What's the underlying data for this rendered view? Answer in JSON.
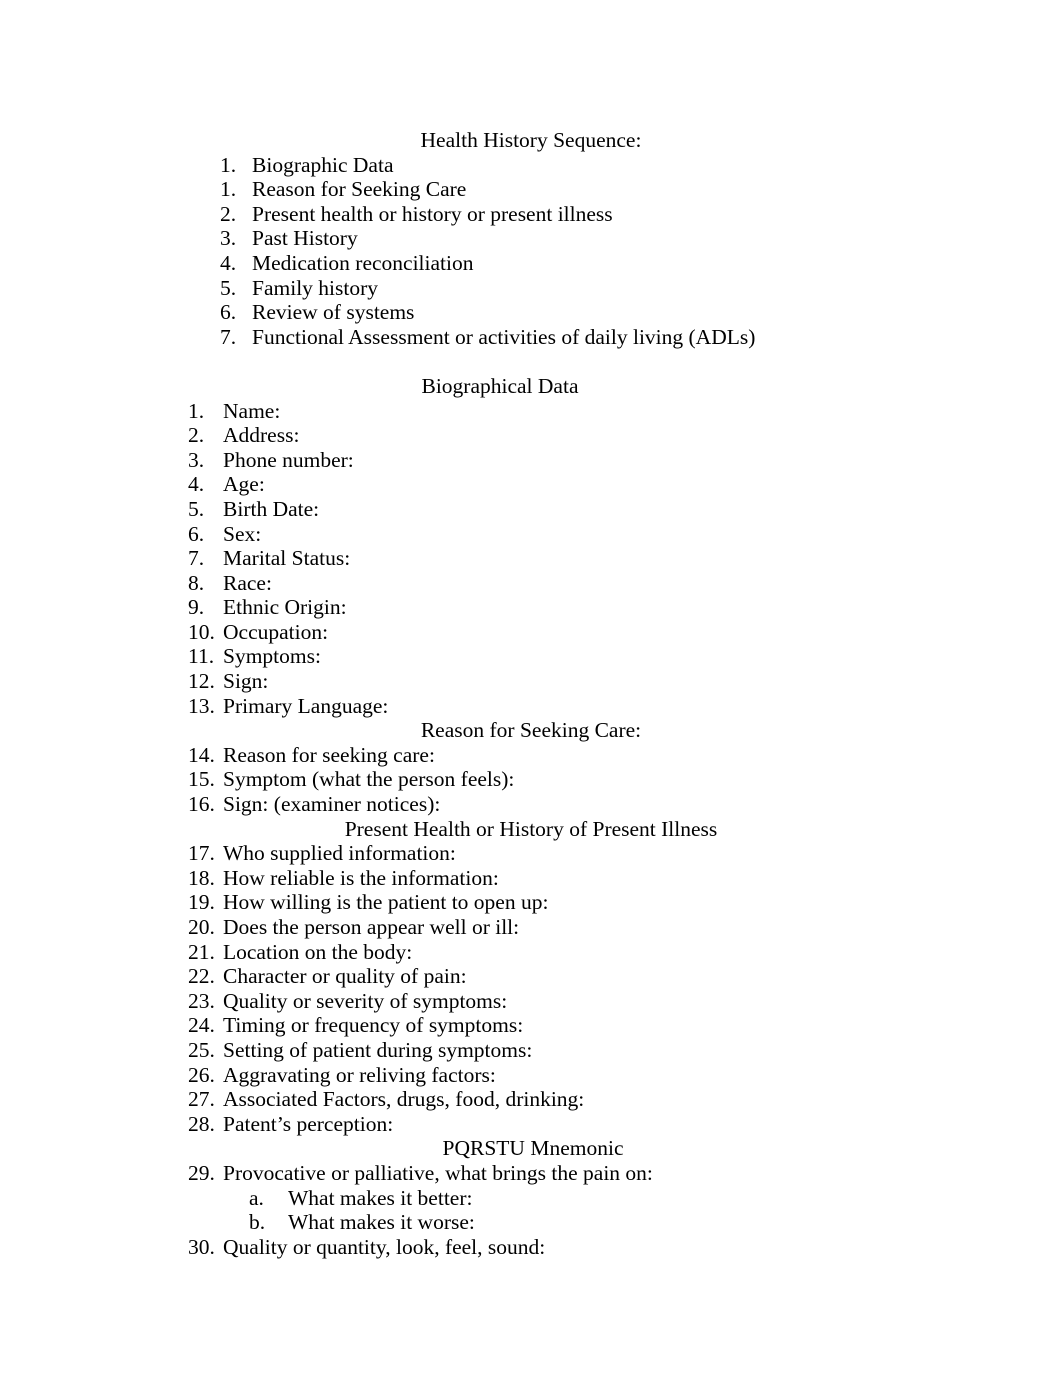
{
  "document": {
    "title": "Health History Sequence:",
    "sections": [
      {
        "id": "health-history-sequence",
        "heading": "Health History Sequence:",
        "heading_style": "h-main",
        "list_style": "list-a",
        "items": [
          {
            "num": "1.",
            "text": "Biographic Data"
          },
          {
            "num": "1.",
            "text": "Reason for Seeking Care"
          },
          {
            "num": "2.",
            "text": "Present health or history or present illness"
          },
          {
            "num": "3.",
            "text": "Past History"
          },
          {
            "num": "4.",
            "text": "Medication reconciliation"
          },
          {
            "num": "5.",
            "text": "Family history"
          },
          {
            "num": "6.",
            "text": "Review of systems"
          },
          {
            "num": "7.",
            "text": "Functional Assessment or activities of daily living (ADLs)"
          }
        ]
      },
      {
        "id": "biographical-data",
        "heading": "Biographical Data",
        "heading_style": "h-bio",
        "list_style": "list-b",
        "items": [
          {
            "num": "1.",
            "text": "Name:"
          },
          {
            "num": "2.",
            "text": "Address:"
          },
          {
            "num": "3.",
            "text": "Phone number:"
          },
          {
            "num": "4.",
            "text": "Age:"
          },
          {
            "num": "5.",
            "text": "Birth Date:"
          },
          {
            "num": "6.",
            "text": "Sex:"
          },
          {
            "num": "7.",
            "text": "Marital Status:"
          },
          {
            "num": "8.",
            "text": "Race:"
          },
          {
            "num": "9.",
            "text": "Ethnic Origin:"
          },
          {
            "num": "10.",
            "text": "Occupation:"
          },
          {
            "num": "11.",
            "text": "Symptoms:"
          },
          {
            "num": "12.",
            "text": "Sign:"
          },
          {
            "num": "13.",
            "text": "Primary Language:"
          }
        ]
      },
      {
        "id": "reason-for-seeking-care",
        "heading": "Reason for Seeking Care:",
        "heading_style": "h-reason",
        "list_style": "list-b",
        "items": [
          {
            "num": "14.",
            "text": "Reason for seeking care:"
          },
          {
            "num": "15.",
            "text": "Symptom (what the person feels):"
          },
          {
            "num": "16.",
            "text": "Sign: (examiner notices):"
          }
        ]
      },
      {
        "id": "present-health-or-history-of-present-illness",
        "heading": "Present Health or History of Present Illness",
        "heading_style": "h-present",
        "list_style": "list-b",
        "items": [
          {
            "num": "17.",
            "text": "Who supplied information:"
          },
          {
            "num": "18.",
            "text": "How reliable is the information:"
          },
          {
            "num": "19.",
            "text": "How willing is the patient to open up:"
          },
          {
            "num": "20.",
            "text": "Does the person appear well or ill:"
          },
          {
            "num": "21.",
            "text": "Location on the body:"
          },
          {
            "num": "22.",
            "text": "Character or quality of pain:"
          },
          {
            "num": "23.",
            "text": "Quality or severity of symptoms:"
          },
          {
            "num": "24.",
            "text": "Timing or frequency of symptoms:"
          },
          {
            "num": "25.",
            "text": "Setting of patient during symptoms:"
          },
          {
            "num": "26.",
            "text": "Aggravating or reliving factors:"
          },
          {
            "num": "27.",
            "text": "Associated Factors, drugs, food, drinking:"
          },
          {
            "num": "28.",
            "text": "Patent’s perception:"
          }
        ]
      },
      {
        "id": "pqrstu-mnemonic",
        "heading": "PQRSTU Mnemonic",
        "heading_style": "h-pqrstu",
        "list_style": "list-b",
        "items": [
          {
            "num": "29.",
            "text": "Provocative or palliative, what brings the pain on:"
          },
          {
            "num": "a.",
            "text": "What makes it better:",
            "sub": true
          },
          {
            "num": "b.",
            "text": "What makes it worse:",
            "sub": true
          },
          {
            "num": "30.",
            "text": "Quality or quantity, look, feel, sound:"
          }
        ]
      }
    ]
  }
}
